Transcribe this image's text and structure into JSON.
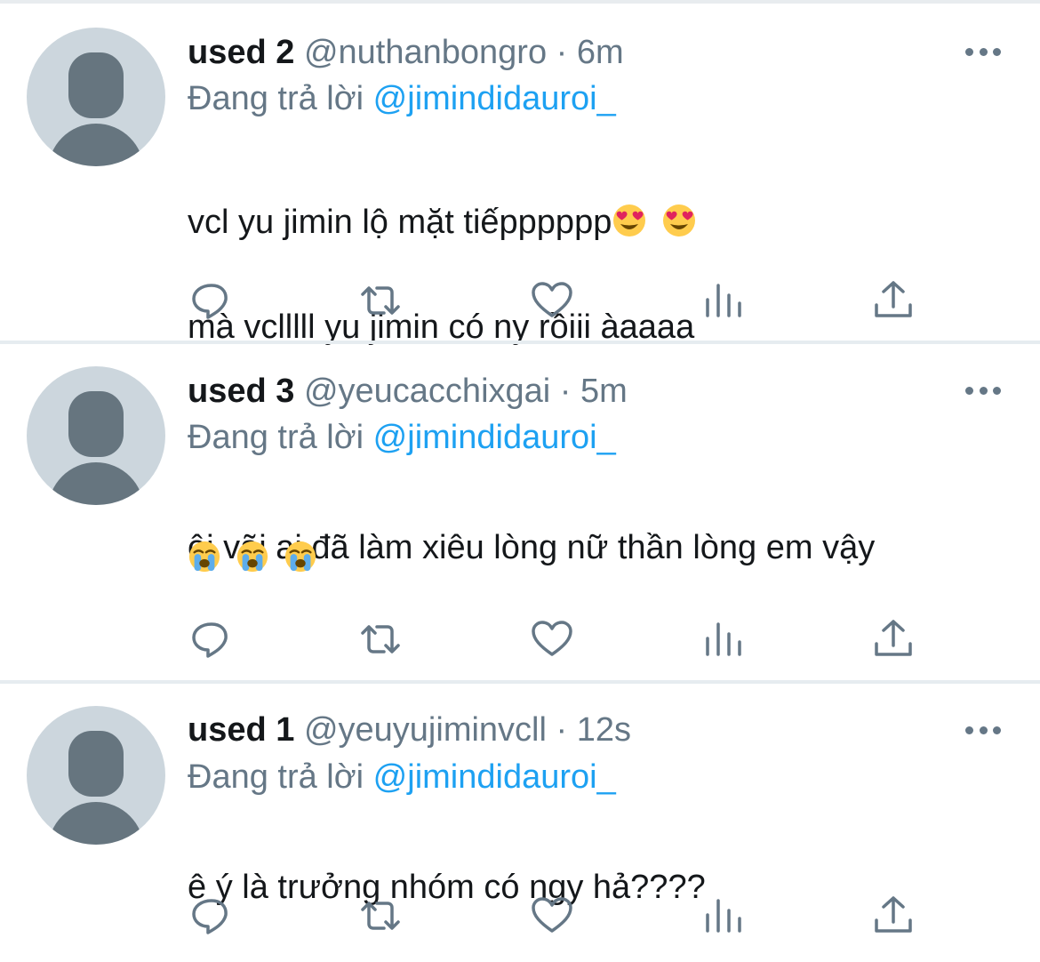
{
  "tweets": [
    {
      "display_name": "used 2",
      "handle": "@nuthanbongro",
      "separator": "·",
      "time": "6m",
      "reply_prefix": "Đang trả lời",
      "reply_to": "@jimindidauroi_",
      "text_line1": "vcl yu jimin lộ mặt tiếpppppp",
      "text_line1_emojis": [
        "heart-eyes-emoji",
        "heart-eyes-emoji"
      ],
      "text_line2": "mà vclllll yu jimin có ny rồiii àaaaa"
    },
    {
      "display_name": "used 3",
      "handle": "@yeucacchixgai",
      "separator": "·",
      "time": "5m",
      "reply_prefix": "Đang trả lời",
      "reply_to": "@jimindidauroi_",
      "text_line1": "ôi vãi ai đã làm xiêu lòng nữ thần lòng em vậy",
      "text_line2_emojis": [
        "loudly-crying-emoji",
        "loudly-crying-emoji",
        "loudly-crying-emoji"
      ]
    },
    {
      "display_name": "used 1",
      "handle": "@yeuyujiminvcll",
      "separator": "·",
      "time": "12s",
      "reply_prefix": "Đang trả lời",
      "reply_to": "@jimindidauroi_",
      "text_line1": "ê ý là trưởng nhóm có ngy hả????"
    }
  ],
  "action_icons": [
    "reply-icon",
    "retweet-icon",
    "like-icon",
    "analytics-icon",
    "share-icon"
  ],
  "colors": {
    "text_primary": "#14171a",
    "text_secondary": "#657786",
    "mention": "#1da1f2",
    "avatar_bg": "#ccd6dd",
    "avatar_fg": "#66757f",
    "divider": "#e6ecf0"
  }
}
